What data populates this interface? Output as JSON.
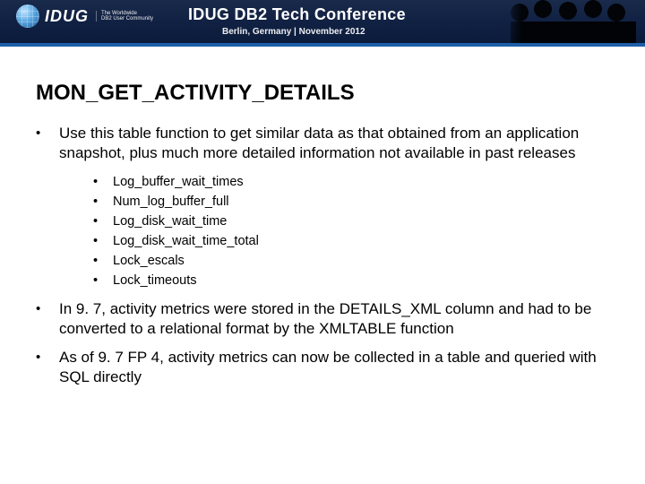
{
  "banner": {
    "logo_text": "IDUG",
    "logo_sub_line1": "The Worldwide",
    "logo_sub_line2": "DB2 User Community",
    "title": "IDUG DB2 Tech Conference",
    "subtitle": "Berlin, Germany  |  November 2012"
  },
  "slide": {
    "title": "MON_GET_ACTIVITY_DETAILS",
    "bullets": [
      {
        "text": "Use this table function to get similar data as that obtained from an application snapshot, plus much more detailed information not available in past releases",
        "sub": [
          "Log_buffer_wait_times",
          "Num_log_buffer_full",
          "Log_disk_wait_time",
          "Log_disk_wait_time_total",
          "Lock_escals",
          "Lock_timeouts"
        ]
      },
      {
        "text": "In 9. 7, activity metrics were stored in the DETAILS_XML column and had to be converted to a relational format by the XMLTABLE function"
      },
      {
        "text": "As of 9. 7 FP 4, activity metrics can now be collected in a table and queried with SQL directly"
      }
    ]
  }
}
